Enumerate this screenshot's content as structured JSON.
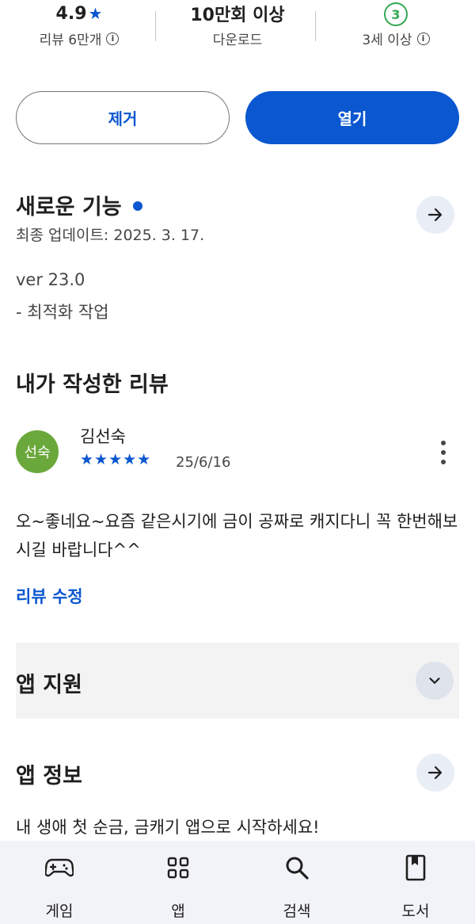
{
  "stats": {
    "rating": {
      "value": "4.9",
      "label": "리뷰 6만개"
    },
    "downloads": {
      "value": "10만회 이상",
      "label": "다운로드"
    },
    "age": {
      "value": "3",
      "label": "3세 이상"
    }
  },
  "actions": {
    "remove_label": "제거",
    "open_label": "열기"
  },
  "whats_new": {
    "title": "새로운 기능",
    "updated": "최종 업데이트: 2025. 3. 17.",
    "version": "ver 23.0",
    "note": "- 최적화 작업"
  },
  "my_review": {
    "title": "내가 작성한 리뷰",
    "avatar_text": "선숙",
    "reviewer": "김선숙",
    "stars": "★★★★★",
    "rating": 5,
    "date": "25/6/16",
    "body": "오~좋네요~요즘 같은시기에 금이 공짜로 캐지다니 꼭 한번해보시길 바랍니다^^",
    "edit_label": "리뷰 수정"
  },
  "app_support": {
    "title": "앱 지원"
  },
  "app_info": {
    "title": "앱 정보",
    "description": "내 생애 첫 순금, 금캐기 앱으로 시작하세요!"
  },
  "bottom_nav": {
    "items": [
      {
        "label": "게임",
        "icon": "gamepad-icon"
      },
      {
        "label": "앱",
        "icon": "apps-grid-icon"
      },
      {
        "label": "검색",
        "icon": "search-icon"
      },
      {
        "label": "도서",
        "icon": "book-icon"
      }
    ]
  },
  "colors": {
    "accent": "#0b57d0",
    "avatar": "#6aa83b",
    "age_badge": "#34a853"
  }
}
